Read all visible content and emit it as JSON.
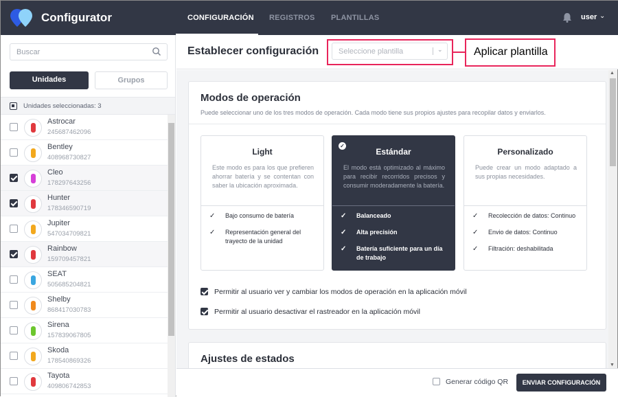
{
  "header": {
    "brand": "Configurator",
    "nav": [
      "CONFIGURACIÓN",
      "REGISTROS",
      "PLANTILLAS"
    ],
    "user": "user"
  },
  "sidebar": {
    "search_placeholder": "Buscar",
    "tabs": [
      "Unidades",
      "Grupos"
    ],
    "selected_label": "Unidades seleccionadas: 3",
    "units": [
      {
        "name": "Astrocar",
        "id": "245687462096",
        "checked": false,
        "color": "#e0393e"
      },
      {
        "name": "Bentley",
        "id": "408968730827",
        "checked": false,
        "color": "#f2a81d"
      },
      {
        "name": "Cleo",
        "id": "178297643256",
        "checked": true,
        "color": "#d63fd8"
      },
      {
        "name": "Hunter",
        "id": "178346590719",
        "checked": true,
        "color": "#e0393e"
      },
      {
        "name": "Jupiter",
        "id": "547034709821",
        "checked": false,
        "color": "#f2a81d"
      },
      {
        "name": "Rainbow",
        "id": "159709457821",
        "checked": true,
        "color": "#e0393e"
      },
      {
        "name": "SEAT",
        "id": "505685204821",
        "checked": false,
        "color": "#3aa6e0"
      },
      {
        "name": "Shelby",
        "id": "868417030783",
        "checked": false,
        "color": "#f08a1d"
      },
      {
        "name": "Sirena",
        "id": "157839067805",
        "checked": false,
        "color": "#6cc62e"
      },
      {
        "name": "Skoda",
        "id": "178540869326",
        "checked": false,
        "color": "#f2a81d"
      },
      {
        "name": "Tayota",
        "id": "409806742853",
        "checked": false,
        "color": "#e0393e"
      }
    ]
  },
  "main": {
    "title": "Establecer configuración",
    "template_placeholder": "Seleccione plantilla",
    "annotation": "Aplicar plantilla",
    "modes_card": {
      "title": "Modos de operación",
      "subtitle": "Puede seleccionar uno de los tres modos de operación. Cada modo tiene sus propios ajustes para recopilar datos y enviarlos.",
      "modes": [
        {
          "title": "Light",
          "desc": "Este modo es para los que prefieren ahorrar batería y se contentan con saber la ubicación aproximada.",
          "features": [
            "Bajo consumo de batería",
            "Representación general del trayecto de la unidad"
          ]
        },
        {
          "title": "Estándar",
          "desc": "El modo está optimizado al máximo para recibir recorridos precisos y consumir moderadamente la batería.",
          "features": [
            "Balanceado",
            "Alta precisión",
            "Batería suficiente para un día de trabajo"
          ]
        },
        {
          "title": "Personalizado",
          "desc": "Puede crear un modo adaptado a sus propias necesidades.",
          "features": [
            "Recolección de datos: Continuo",
            "Envio de datos: Continuo",
            "Filtración: deshabilitada"
          ]
        }
      ],
      "permissions": [
        "Permitir al usuario ver y cambiar los modos de operación en la aplicación móvil",
        "Permitir al usuario desactivar el rastreador en la aplicación móvil"
      ]
    },
    "states_card": {
      "title": "Ajustes de estados"
    }
  },
  "footer": {
    "qr_label": "Generar código QR",
    "send_label": "ENVIAR CONFIGURACIÓN"
  }
}
